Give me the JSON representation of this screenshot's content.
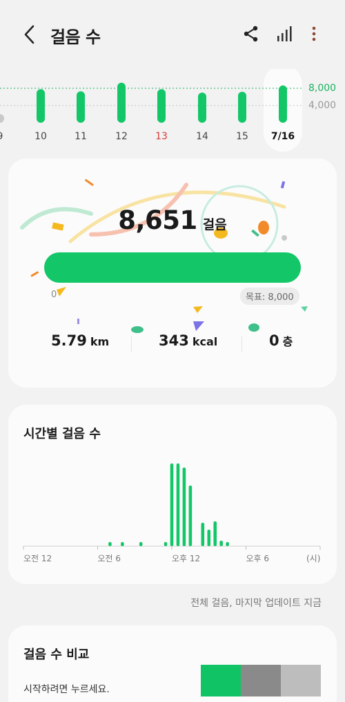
{
  "header": {
    "title": "걸음 수",
    "icons": [
      "back-arrow-icon",
      "share-icon",
      "signal-bars-icon",
      "more-vert-icon"
    ]
  },
  "weekly": {
    "labels": [
      "9",
      "10",
      "11",
      "12",
      "13",
      "14",
      "15",
      "7/16"
    ],
    "values": [
      2000,
      7800,
      7300,
      9300,
      7800,
      7000,
      7200,
      8651
    ],
    "highlight_label": "13",
    "selected_label": "7/16",
    "ref_high_label": "8,000",
    "ref_low_label": "4,000",
    "color_bar": "#13c768",
    "color_past": "#c9c9c9"
  },
  "summary": {
    "steps": "8,651",
    "steps_unit": "걸음",
    "progress_fraction": 1.0,
    "zero_label": "0",
    "goal_label": "목표: 8,000",
    "distance_value": "5.79",
    "distance_unit": "km",
    "calories_value": "343",
    "calories_unit": "kcal",
    "floors_value": "0",
    "floors_unit": "층"
  },
  "hourly": {
    "title": "시간별 걸음 수",
    "ticks": [
      "오전 12",
      "오전 6",
      "오후 12",
      "오후 6",
      "(시)"
    ],
    "bars": [
      {
        "hour": 7.0,
        "value": 6
      },
      {
        "hour": 8.0,
        "value": 6
      },
      {
        "hour": 9.5,
        "value": 6
      },
      {
        "hour": 11.5,
        "value": 6
      },
      {
        "hour": 12.0,
        "value": 120
      },
      {
        "hour": 12.5,
        "value": 120
      },
      {
        "hour": 13.0,
        "value": 114
      },
      {
        "hour": 13.5,
        "value": 88
      },
      {
        "hour": 14.5,
        "value": 34
      },
      {
        "hour": 15.0,
        "value": 24
      },
      {
        "hour": 15.5,
        "value": 36
      },
      {
        "hour": 16.0,
        "value": 8
      },
      {
        "hour": 16.5,
        "value": 6
      }
    ]
  },
  "updated": "전체 걸음, 마지막 업데이트 지금",
  "compare": {
    "title": "걸음 수 비교",
    "hint": "시작하려면 누르세요.",
    "colors": [
      "#10c466",
      "#8a8a8a",
      "#bdbdbd"
    ]
  }
}
